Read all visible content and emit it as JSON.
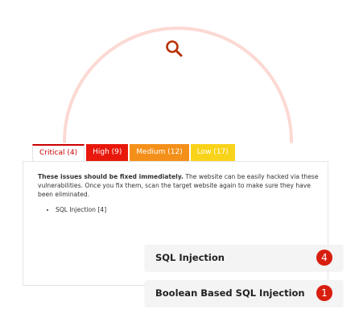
{
  "tabs": {
    "critical": "Critical (4)",
    "high": "High (9)",
    "medium": "Medium (12)",
    "low": "Low (17)"
  },
  "panel": {
    "bold_text": "These issues should be fixed immediately.",
    "body_text": "The website can be easily hacked via these vulnerabilities. Once you fix them, scan the target website again to make sure they have been eliminated.",
    "items": [
      "SQL Injection [4]"
    ]
  },
  "cards": [
    {
      "label": "SQL Injection",
      "count": "4"
    },
    {
      "label": "Boolean Based SQL Injection",
      "count": "1"
    }
  ],
  "colors": {
    "critical": "#cc0000",
    "high": "#e8190c",
    "medium": "#f4901a",
    "low": "#f8d31a",
    "badge": "#d81e0f",
    "arc": "#fcd9d3",
    "icon": "#b83207"
  },
  "icons": {
    "hero": "search-icon"
  }
}
